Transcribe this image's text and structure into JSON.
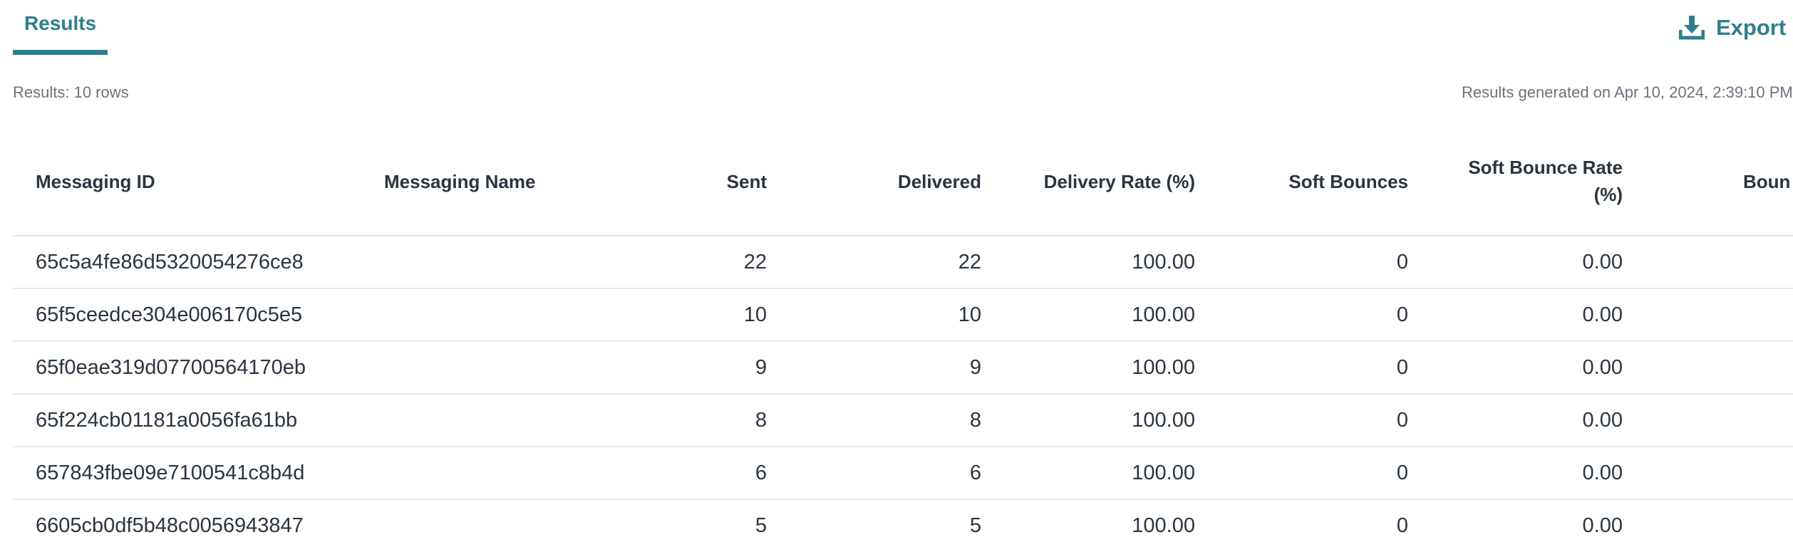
{
  "tabs": [
    {
      "label": "Results",
      "active": true
    }
  ],
  "export": {
    "label": "Export",
    "icon": "download-icon"
  },
  "meta": {
    "row_count_text": "Results: 10 rows",
    "generated_text": "Results generated on Apr 10, 2024, 2:39:10 PM"
  },
  "accent_color": "#2e7f8c",
  "table": {
    "columns": [
      {
        "label": "Messaging ID"
      },
      {
        "label": "Messaging Name"
      },
      {
        "label": "Sent"
      },
      {
        "label": "Delivered"
      },
      {
        "label": "Delivery Rate (%)"
      },
      {
        "label": "Soft Bounces"
      },
      {
        "label": "Soft Bounce Rate",
        "label2": "(%)"
      },
      {
        "label": "Boun"
      }
    ],
    "rows": [
      {
        "id": "65c5a4fe86d5320054276ce8",
        "name": "",
        "sent": "22",
        "delivered": "22",
        "delivery_rate": "100.00",
        "soft_bounces": "0",
        "soft_bounce_rate": "0.00"
      },
      {
        "id": "65f5ceedce304e006170c5e5",
        "name": "",
        "sent": "10",
        "delivered": "10",
        "delivery_rate": "100.00",
        "soft_bounces": "0",
        "soft_bounce_rate": "0.00"
      },
      {
        "id": "65f0eae319d07700564170eb",
        "name": "",
        "sent": "9",
        "delivered": "9",
        "delivery_rate": "100.00",
        "soft_bounces": "0",
        "soft_bounce_rate": "0.00"
      },
      {
        "id": "65f224cb01181a0056fa61bb",
        "name": "",
        "sent": "8",
        "delivered": "8",
        "delivery_rate": "100.00",
        "soft_bounces": "0",
        "soft_bounce_rate": "0.00"
      },
      {
        "id": "657843fbe09e7100541c8b4d",
        "name": "",
        "sent": "6",
        "delivered": "6",
        "delivery_rate": "100.00",
        "soft_bounces": "0",
        "soft_bounce_rate": "0.00"
      },
      {
        "id": "6605cb0df5b48c0056943847",
        "name": "",
        "sent": "5",
        "delivered": "5",
        "delivery_rate": "100.00",
        "soft_bounces": "0",
        "soft_bounce_rate": "0.00"
      }
    ]
  }
}
